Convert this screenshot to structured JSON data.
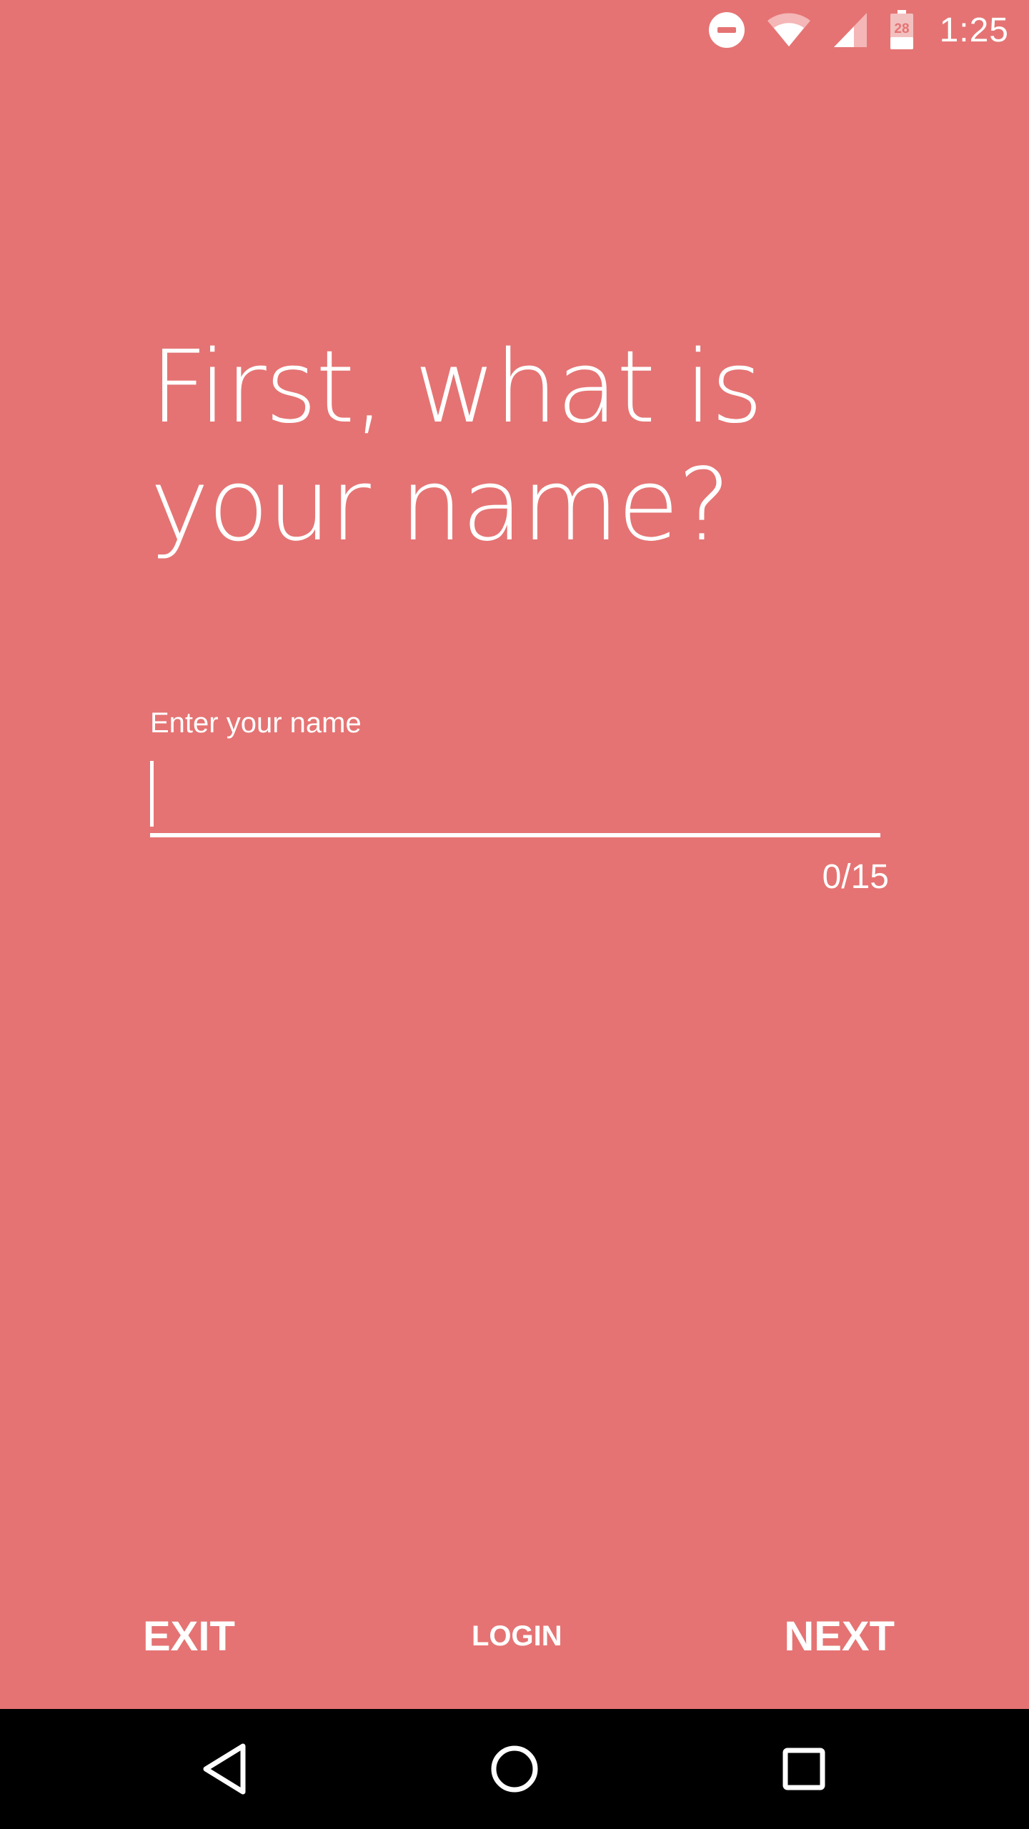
{
  "status_bar": {
    "time": "1:25",
    "battery_level": "28",
    "icons": [
      "do-not-disturb-icon",
      "wifi-icon",
      "cell-signal-icon",
      "battery-icon"
    ]
  },
  "headline": {
    "line1": "First, what is",
    "line2": "your name?"
  },
  "name_field": {
    "label": "Enter your name",
    "value": "",
    "counter": "0/15"
  },
  "actions": {
    "exit_label": "EXIT",
    "login_label": "LOGIN",
    "next_label": "NEXT"
  },
  "nav_bar": {
    "icons": [
      "back-icon",
      "home-icon",
      "recents-icon"
    ]
  },
  "colors": {
    "background": "#e57373",
    "text": "#ffffff",
    "nav_bar": "#000000"
  }
}
